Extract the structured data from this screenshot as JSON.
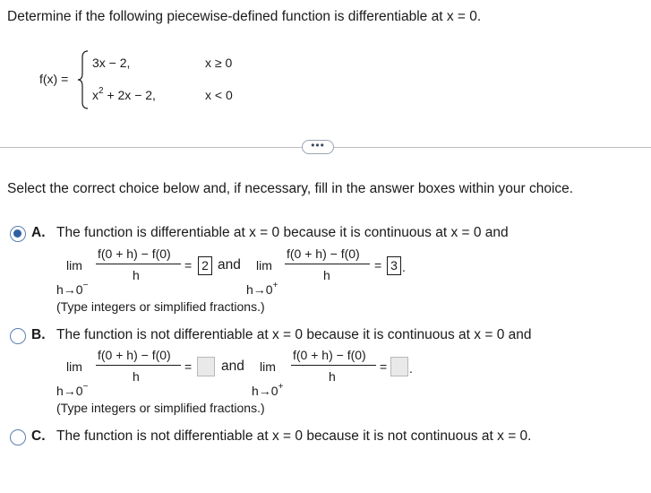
{
  "question": "Determine if the following piecewise-defined function is differentiable at x = 0.",
  "function": {
    "lhs": "f(x) =",
    "piece1_expr": "3x − 2,",
    "piece1_cond": "x ≥ 0",
    "piece2_x": "x",
    "piece2_exp": "2",
    "piece2_rest": " + 2x − 2,",
    "piece2_cond": "x < 0"
  },
  "more_button": "•••",
  "instruction": "Select the correct choice below and, if necessary, fill in the answer boxes within your choice.",
  "limit": {
    "numerator": "f(0 + h) − f(0)",
    "denominator": "h",
    "lim": "lim",
    "sub_left_base": "h→0",
    "sub_left_sign": "−",
    "sub_right_base": "h→0",
    "sub_right_sign": "+",
    "equals": "=",
    "and": "and"
  },
  "options": [
    {
      "letter": "A.",
      "text": "The function is differentiable at x = 0 because it is continuous at x = 0 and",
      "selected": true,
      "left_value": "2",
      "right_value": "3",
      "trailing": ".",
      "note": "(Type integers or simplified fractions.)"
    },
    {
      "letter": "B.",
      "text": "The function is not differentiable at x = 0 because it is continuous at x = 0 and",
      "selected": false,
      "left_value": "",
      "right_value": "",
      "trailing": ".",
      "note": "(Type integers or simplified fractions.)"
    },
    {
      "letter": "C.",
      "text": "The function is not differentiable at x = 0 because it is not continuous at x = 0.",
      "selected": false
    }
  ],
  "colors": {
    "radio_selected": "#2e5fa3",
    "radio_border": "#5b7fb1",
    "divider": "#bdbdbd"
  }
}
